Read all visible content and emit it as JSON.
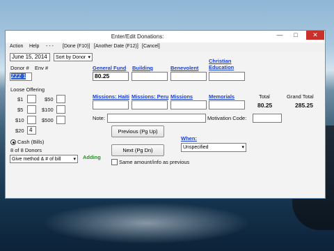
{
  "window": {
    "title": "Enter/Edit Donations:",
    "minimize": "—",
    "maximize": "□",
    "close": "✕"
  },
  "menu": [
    "Action",
    "Help",
    "- - -",
    "[Done (F10)]",
    "[Another Date (F12)]",
    "[Cancel]"
  ],
  "header": {
    "date": "June 15, 2014",
    "sort_select": "Sort by Donor"
  },
  "donor": {
    "donor_label": "Donor #",
    "env_label": "Env #",
    "donor_value": "ZZZ 1"
  },
  "loose": {
    "title": "Loose Offering",
    "denoms": [
      "$1",
      "$5",
      "$10",
      "$20",
      "$50",
      "$100",
      "$500"
    ],
    "twenty_value": "4"
  },
  "funds": {
    "general_fund": "General Fund",
    "general_fund_value": "80.25",
    "building": "Building",
    "benevolent": "Benevolent",
    "christian_education_line1": "Christian",
    "christian_education_line2": "Education",
    "missions_haiti": "Missions: Haiti",
    "missions_peru": "Missions: Peru",
    "missions": "Missions",
    "memorials": "Memorials"
  },
  "totals": {
    "total_label": "Total",
    "total_value": "80.25",
    "grand_label": "Grand Total",
    "grand_value": "285.25"
  },
  "note_label": "Note:",
  "motivation_label": "Motivation Code:",
  "nav": {
    "prev": "Previous (Pg Up)",
    "next": "Next (Pg Dn)"
  },
  "when": {
    "label": "When:",
    "value": "Unspecified"
  },
  "payment": {
    "cash_label": "Cash (Bills)",
    "donors_count": "8 of 8 Donors",
    "give_method": "Give method & # of bill",
    "adding": "Adding"
  },
  "same_amount_label": "Same amount/info as previous",
  "colors": {
    "link": "#1a3fd1",
    "adding": "#2e8b2e",
    "close_button": "#c9302c"
  }
}
